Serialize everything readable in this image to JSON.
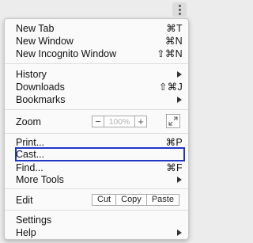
{
  "menu": {
    "new_tab": {
      "label": "New Tab",
      "shortcut": "⌘T"
    },
    "new_window": {
      "label": "New Window",
      "shortcut": "⌘N"
    },
    "new_incognito": {
      "label": "New Incognito Window",
      "shortcut": "⇧⌘N"
    },
    "history": {
      "label": "History"
    },
    "downloads": {
      "label": "Downloads",
      "shortcut": "⇧⌘J"
    },
    "bookmarks": {
      "label": "Bookmarks"
    },
    "zoom": {
      "label": "Zoom",
      "minus": "−",
      "value": "100%",
      "plus": "+"
    },
    "print": {
      "label": "Print...",
      "shortcut": "⌘P"
    },
    "cast": {
      "label": "Cast..."
    },
    "find": {
      "label": "Find...",
      "shortcut": "⌘F"
    },
    "more_tools": {
      "label": "More Tools"
    },
    "edit": {
      "label": "Edit",
      "cut": "Cut",
      "copy": "Copy",
      "paste": "Paste"
    },
    "settings": {
      "label": "Settings"
    },
    "help": {
      "label": "Help"
    }
  },
  "colors": {
    "highlight_border": "#1f36c8"
  },
  "icons": {
    "menu_button": "kebab-icon",
    "fullscreen": "fullscreen-icon",
    "submenu": "chevron-right-icon"
  }
}
